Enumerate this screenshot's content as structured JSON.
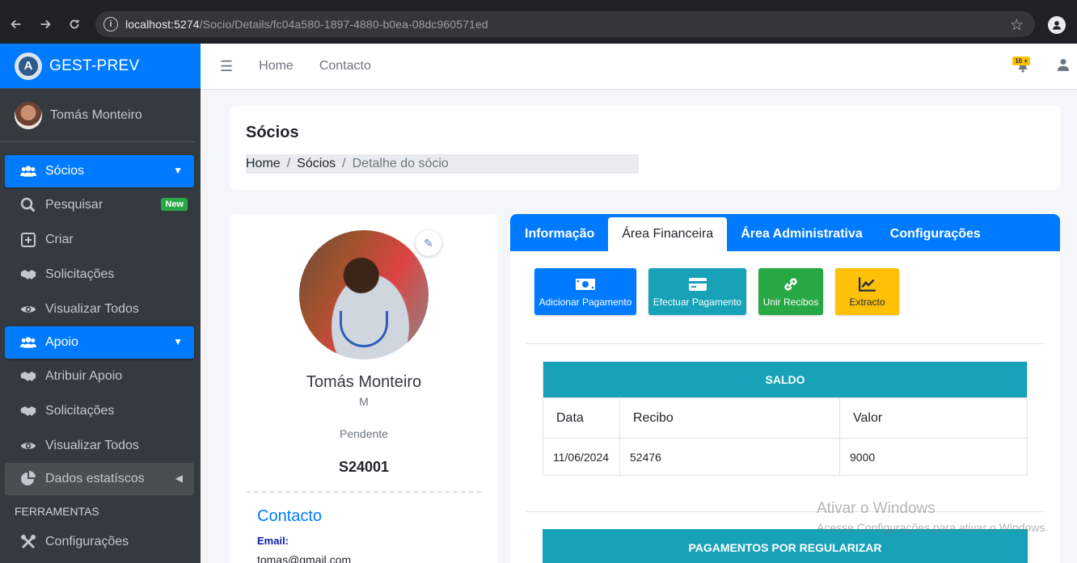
{
  "browser": {
    "url_host": "localhost:5274",
    "url_path": "/Socio/Details/fc04a580-1897-4880-b0ea-08dc960571ed"
  },
  "sidebar": {
    "brand": "GEST-PREV",
    "user_name": "Tomás Monteiro",
    "items": [
      {
        "label": "Sócios",
        "icon": "users-icon",
        "active": true,
        "chevron": "down"
      },
      {
        "label": "Pesquisar",
        "icon": "search-icon",
        "badge": "New"
      },
      {
        "label": "Criar",
        "icon": "plus-square-icon"
      },
      {
        "label": "Solicitações",
        "icon": "handshake-icon"
      },
      {
        "label": "Visualizar Todos",
        "icon": "eye-icon"
      },
      {
        "label": "Apoio",
        "icon": "users-icon",
        "active": true,
        "chevron": "down"
      },
      {
        "label": "Atribuir Apoio",
        "icon": "handshake-icon"
      },
      {
        "label": "Solicitações",
        "icon": "handshake-icon"
      },
      {
        "label": "Visualizar Todos",
        "icon": "eye-icon"
      },
      {
        "label": "Dados estatíscos",
        "icon": "pie-chart-icon",
        "chevron": "left"
      }
    ],
    "section_header": "FERRAMENTAS",
    "tools_item": {
      "label": "Configurações",
      "icon": "tools-icon"
    }
  },
  "topnav": {
    "links": [
      "Home",
      "Contacto"
    ],
    "notification_badge": "10 +"
  },
  "page": {
    "title": "Sócios",
    "breadcrumb": [
      "Home",
      "Sócios",
      "Detalhe do sócio"
    ]
  },
  "profile": {
    "name": "Tomás Monteiro",
    "gender": "M",
    "status": "Pendente",
    "code": "S24001",
    "contact_title": "Contacto",
    "email_label": "Email:",
    "email_value": "tomas@gmail.com"
  },
  "tabs": [
    "Informação",
    "Área Financeira",
    "Área Administrativa",
    "Configurações"
  ],
  "active_tab": "Área Financeira",
  "actions": [
    {
      "label": "Adicionar Pagamento",
      "icon": "money-bill-icon",
      "color": "#007bff"
    },
    {
      "label": "Efectuar Pagamento",
      "icon": "credit-card-icon",
      "color": "#17a2b8"
    },
    {
      "label": "Unir Recibos",
      "icon": "link-icon",
      "color": "#28a745"
    },
    {
      "label": "Extracto",
      "icon": "chart-line-icon",
      "color": "#ffc107"
    }
  ],
  "saldo": {
    "title": "SALDO",
    "columns": [
      "Data",
      "Recibo",
      "Valor"
    ],
    "rows": [
      [
        "11/06/2024",
        "52476",
        "9000"
      ]
    ]
  },
  "pending_title": "PAGAMENTOS POR REGULARIZAR",
  "watermark": {
    "title": "Ativar o Windows",
    "subtitle": "Acesse Configurações para ativar o Windows."
  }
}
